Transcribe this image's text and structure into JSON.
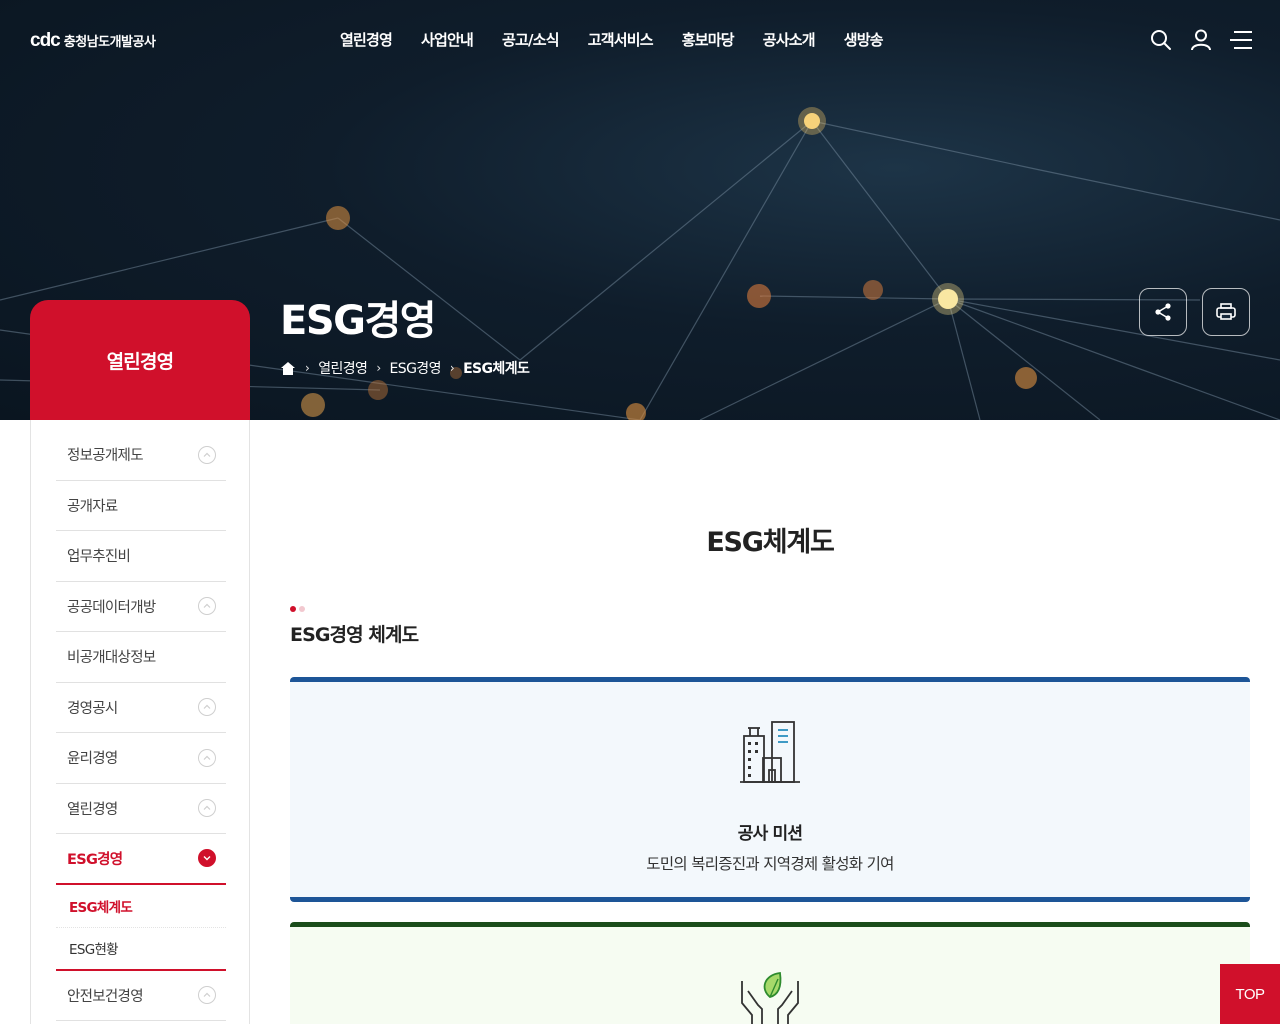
{
  "header": {
    "logo_mark": "cdc",
    "logo_name": "충청남도개발공사",
    "nav": [
      "열린경영",
      "사업안내",
      "공고/소식",
      "고객서비스",
      "홍보마당",
      "공사소개",
      "생방송"
    ],
    "icons": [
      "search-icon",
      "user-icon",
      "menu-icon"
    ]
  },
  "hero": {
    "title": "ESG경영",
    "breadcrumb": [
      "열린경영",
      "ESG경영",
      "ESG체계도"
    ],
    "buttons": [
      "share-icon",
      "print-icon"
    ]
  },
  "sidebar": {
    "title": "열린경영",
    "items": [
      {
        "label": "정보공개제도",
        "expandable": true
      },
      {
        "label": "공개자료",
        "expandable": false
      },
      {
        "label": "업무추진비",
        "expandable": false
      },
      {
        "label": "공공데이터개방",
        "expandable": true
      },
      {
        "label": "비공개대상정보",
        "expandable": false
      },
      {
        "label": "경영공시",
        "expandable": true
      },
      {
        "label": "윤리경영",
        "expandable": true
      },
      {
        "label": "열린경영",
        "expandable": true
      },
      {
        "label": "ESG경영",
        "expandable": true,
        "active": true
      },
      {
        "label": "안전보건경영",
        "expandable": true
      }
    ],
    "sub_items": [
      {
        "label": "ESG체계도",
        "current": true
      },
      {
        "label": "ESG현황",
        "current": false
      }
    ]
  },
  "content": {
    "page_title": "ESG체계도",
    "section_title": "ESG경영 체계도",
    "mission": {
      "title": "공사 미션",
      "desc": "도민의 복리증진과 지역경제 활성화 기여",
      "color": "#1d5597"
    },
    "vision_color": "#1b4d1b"
  },
  "top_button": "TOP",
  "colors": {
    "accent": "#d0102b",
    "mission_border": "#1d5597",
    "vision_border": "#1b4d1b"
  }
}
